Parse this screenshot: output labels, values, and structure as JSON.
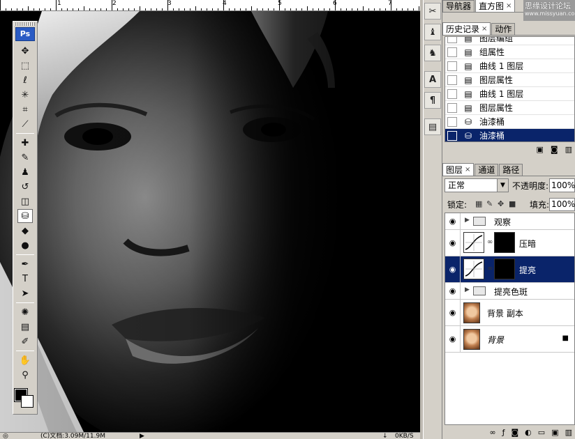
{
  "app": {
    "logo": "Ps"
  },
  "ruler": {
    "labels": [
      "1",
      "2",
      "3",
      "4",
      "5",
      "6",
      "7"
    ]
  },
  "status": {
    "doc_info": "(C)文档:3.09M/11.9M",
    "speed_down": "0KB/S",
    "speed_up": "0KB/S"
  },
  "tools": [
    {
      "name": "move-tool",
      "icon": "move-icon",
      "glyph": "✥"
    },
    {
      "name": "marquee-tool",
      "icon": "marquee-icon",
      "glyph": "⬚"
    },
    {
      "name": "lasso-tool",
      "icon": "lasso-icon",
      "glyph": "ℓ"
    },
    {
      "name": "magic-wand-tool",
      "icon": "magic-wand-icon",
      "glyph": "✳"
    },
    {
      "name": "crop-tool",
      "icon": "crop-icon",
      "glyph": "⌗"
    },
    {
      "name": "slice-tool",
      "icon": "slice-icon",
      "glyph": "⟋"
    },
    {
      "name": "healing-brush-tool",
      "icon": "bandage-icon",
      "glyph": "✚"
    },
    {
      "name": "brush-tool",
      "icon": "brush-icon",
      "glyph": "✎"
    },
    {
      "name": "clone-stamp-tool",
      "icon": "stamp-icon",
      "glyph": "♟"
    },
    {
      "name": "history-brush-tool",
      "icon": "history-brush-icon",
      "glyph": "↺"
    },
    {
      "name": "eraser-tool",
      "icon": "eraser-icon",
      "glyph": "◫"
    },
    {
      "name": "paint-bucket-tool",
      "icon": "paint-bucket-icon",
      "glyph": "⛁"
    },
    {
      "name": "blur-tool",
      "icon": "blur-icon",
      "glyph": "◆"
    },
    {
      "name": "dodge-tool",
      "icon": "dodge-icon",
      "glyph": "●"
    },
    {
      "name": "pen-tool",
      "icon": "pen-icon",
      "glyph": "✒"
    },
    {
      "name": "type-tool",
      "icon": "type-icon",
      "glyph": "T"
    },
    {
      "name": "path-selection-tool",
      "icon": "arrow-icon",
      "glyph": "➤"
    },
    {
      "name": "shape-tool",
      "icon": "shape-icon",
      "glyph": "✺"
    },
    {
      "name": "notes-tool",
      "icon": "notes-icon",
      "glyph": "▤"
    },
    {
      "name": "eyedropper-tool",
      "icon": "eyedropper-icon",
      "glyph": "✐"
    },
    {
      "name": "hand-tool",
      "icon": "hand-icon",
      "glyph": "✋"
    },
    {
      "name": "zoom-tool",
      "icon": "zoom-icon",
      "glyph": "⚲"
    }
  ],
  "active_tool": "paint-bucket-tool",
  "dock": [
    {
      "name": "dock-tool-presets-button",
      "icon": "scissors-icon",
      "glyph": "✂"
    },
    {
      "name": "dock-brushes-button",
      "icon": "stack-icon",
      "glyph": "♝"
    },
    {
      "name": "dock-clone-button",
      "icon": "clone-icon",
      "glyph": "♞"
    },
    {
      "name": "dock-character-button",
      "icon": "character-icon",
      "glyph": "A"
    },
    {
      "name": "dock-paragraph-button",
      "icon": "paragraph-icon",
      "glyph": "¶"
    },
    {
      "name": "dock-notes-button",
      "icon": "list-icon",
      "glyph": "▤"
    }
  ],
  "nav_tabs": [
    {
      "label": "导航器",
      "active": false,
      "close": false
    },
    {
      "label": "直方图",
      "active": true,
      "close": true
    }
  ],
  "watermark": {
    "line1": "思缘设计论坛",
    "line2": "www.missyuan.com"
  },
  "history_tabs": [
    {
      "label": "历史记录",
      "active": true,
      "close": true
    },
    {
      "label": "动作",
      "active": false,
      "close": false
    }
  ],
  "history": [
    {
      "label": "图层编组",
      "icon": "doc-icon",
      "glyph": "▤",
      "selected": false
    },
    {
      "label": "组属性",
      "icon": "doc-icon",
      "glyph": "▤",
      "selected": false
    },
    {
      "label": "曲线 1 图层",
      "icon": "doc-icon",
      "glyph": "▤",
      "selected": false
    },
    {
      "label": "图层属性",
      "icon": "doc-icon",
      "glyph": "▤",
      "selected": false
    },
    {
      "label": "曲线 1 图层",
      "icon": "doc-icon",
      "glyph": "▤",
      "selected": false
    },
    {
      "label": "图层属性",
      "icon": "doc-icon",
      "glyph": "▤",
      "selected": false
    },
    {
      "label": "油漆桶",
      "icon": "paint-bucket-icon",
      "glyph": "⛁",
      "selected": false
    },
    {
      "label": "油漆桶",
      "icon": "paint-bucket-icon",
      "glyph": "⛁",
      "selected": true
    }
  ],
  "layer_tabs": [
    {
      "label": "图层",
      "active": true,
      "close": true
    },
    {
      "label": "通道",
      "active": false,
      "close": false
    },
    {
      "label": "路径",
      "active": false,
      "close": false
    }
  ],
  "layer_controls": {
    "blend_mode": "正常",
    "opacity_label": "不透明度:",
    "opacity_value": "100%",
    "lock_label": "锁定:",
    "fill_label": "填充:",
    "fill_value": "100%"
  },
  "layers": [
    {
      "name": "观察",
      "type": "group",
      "selected": false,
      "italic": false,
      "locked": false
    },
    {
      "name": "压暗",
      "type": "adjustment",
      "selected": false,
      "italic": false,
      "locked": false
    },
    {
      "name": "提亮",
      "type": "adjustment",
      "selected": true,
      "italic": false,
      "locked": false
    },
    {
      "name": "提亮色斑",
      "type": "group",
      "selected": false,
      "italic": false,
      "locked": false
    },
    {
      "name": "背景 副本",
      "type": "pixel",
      "selected": false,
      "italic": false,
      "locked": false
    },
    {
      "name": "背景",
      "type": "pixel",
      "selected": false,
      "italic": true,
      "locked": true
    }
  ]
}
